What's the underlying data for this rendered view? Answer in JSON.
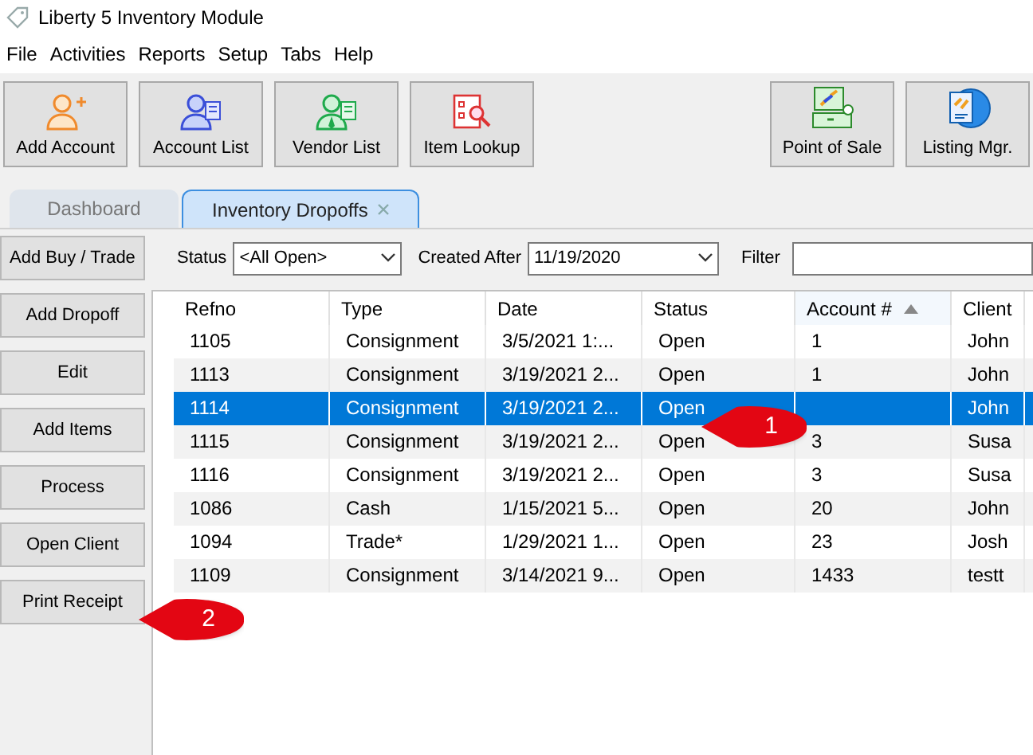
{
  "window": {
    "title": "Liberty 5 Inventory Module"
  },
  "menu": [
    "File",
    "Activities",
    "Reports",
    "Setup",
    "Tabs",
    "Help"
  ],
  "toolbar_left": [
    {
      "label": "Add Account",
      "kind": "add-account"
    },
    {
      "label": "Account List",
      "kind": "account-list"
    },
    {
      "label": "Vendor List",
      "kind": "vendor-list"
    },
    {
      "label": "Item Lookup",
      "kind": "item-lookup"
    }
  ],
  "toolbar_right": [
    {
      "label": "Point of Sale",
      "kind": "pos"
    },
    {
      "label": "Listing Mgr.",
      "kind": "listing"
    }
  ],
  "tabs": [
    {
      "label": "Dashboard",
      "selected": false,
      "closable": false
    },
    {
      "label": "Inventory Dropoffs",
      "selected": true,
      "closable": true
    }
  ],
  "side_buttons": [
    "Add Buy / Trade",
    "Add Dropoff",
    "Edit",
    "Add Items",
    "Process",
    "Open Client",
    "Print Receipt"
  ],
  "filters": {
    "status_label": "Status",
    "status_value": "<All Open>",
    "created_label": "Created After",
    "created_value": "11/19/2020",
    "filter_label": "Filter"
  },
  "table": {
    "columns": [
      {
        "label": "Refno",
        "sorted": false
      },
      {
        "label": "Type",
        "sorted": false
      },
      {
        "label": "Date",
        "sorted": false
      },
      {
        "label": "Status",
        "sorted": false
      },
      {
        "label": "Account #",
        "sorted": true
      },
      {
        "label": "Client",
        "sorted": false
      }
    ],
    "rows": [
      {
        "cells": [
          "1105",
          "Consignment",
          "3/5/2021 1:...",
          "Open",
          "1",
          "John"
        ],
        "selected": false
      },
      {
        "cells": [
          "1113",
          "Consignment",
          "3/19/2021 2...",
          "Open",
          "1",
          "John"
        ],
        "selected": false
      },
      {
        "cells": [
          "1114",
          "Consignment",
          "3/19/2021 2...",
          "Open",
          "",
          "John"
        ],
        "selected": true
      },
      {
        "cells": [
          "1115",
          "Consignment",
          "3/19/2021 2...",
          "Open",
          "3",
          "Susa"
        ],
        "selected": false
      },
      {
        "cells": [
          "1116",
          "Consignment",
          "3/19/2021 2...",
          "Open",
          "3",
          "Susa"
        ],
        "selected": false
      },
      {
        "cells": [
          "1086",
          "Cash",
          "1/15/2021 5...",
          "Open",
          "20",
          "John"
        ],
        "selected": false
      },
      {
        "cells": [
          "1094",
          "Trade*",
          "1/29/2021 1...",
          "Open",
          "23",
          "Josh"
        ],
        "selected": false
      },
      {
        "cells": [
          "1109",
          "Consignment",
          "3/14/2021 9...",
          "Open",
          "1433",
          "testt"
        ],
        "selected": false
      }
    ]
  },
  "callouts": [
    {
      "label": "1"
    },
    {
      "label": "2"
    }
  ]
}
